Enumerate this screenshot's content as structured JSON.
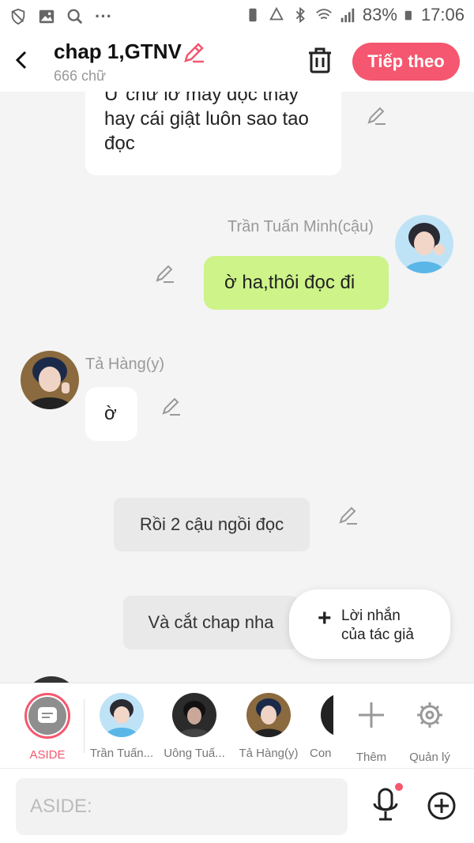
{
  "status_bar": {
    "battery": "83%",
    "time": "17:06",
    "dots": "···"
  },
  "header": {
    "title": "chap 1,GTNV",
    "word_count": "666 chữ",
    "next_label": "Tiếp theo"
  },
  "messages": [
    {
      "text": "Ư chứ lỡ mày đọc thấy hay cái giật luôn sao tao đọc"
    },
    {
      "name": "Trần Tuấn Minh(cậu)",
      "text": "ờ ha,thôi đọc đi"
    },
    {
      "name": "Tả Hàng(y)",
      "text": "ờ"
    },
    {
      "text": "Rồi 2 cậu ngồi đọc"
    },
    {
      "text": "Và cắt chap nha"
    }
  ],
  "popup": {
    "plus": "+",
    "label_line1": "Lời nhắn",
    "label_line2": "của tác giả"
  },
  "characters": [
    {
      "label": "ASIDE"
    },
    {
      "label": "Trần Tuấn..."
    },
    {
      "label": "Uông Tuấ..."
    },
    {
      "label": "Tả Hàng(y)"
    },
    {
      "label": "Con"
    }
  ],
  "actions": {
    "add_label": "Thêm",
    "manage_label": "Quản lý"
  },
  "input": {
    "placeholder": "ASIDE:"
  },
  "colors": {
    "accent": "#f4576f",
    "green_bubble": "#cdf389",
    "aside_bubble": "#e9e9e9"
  }
}
